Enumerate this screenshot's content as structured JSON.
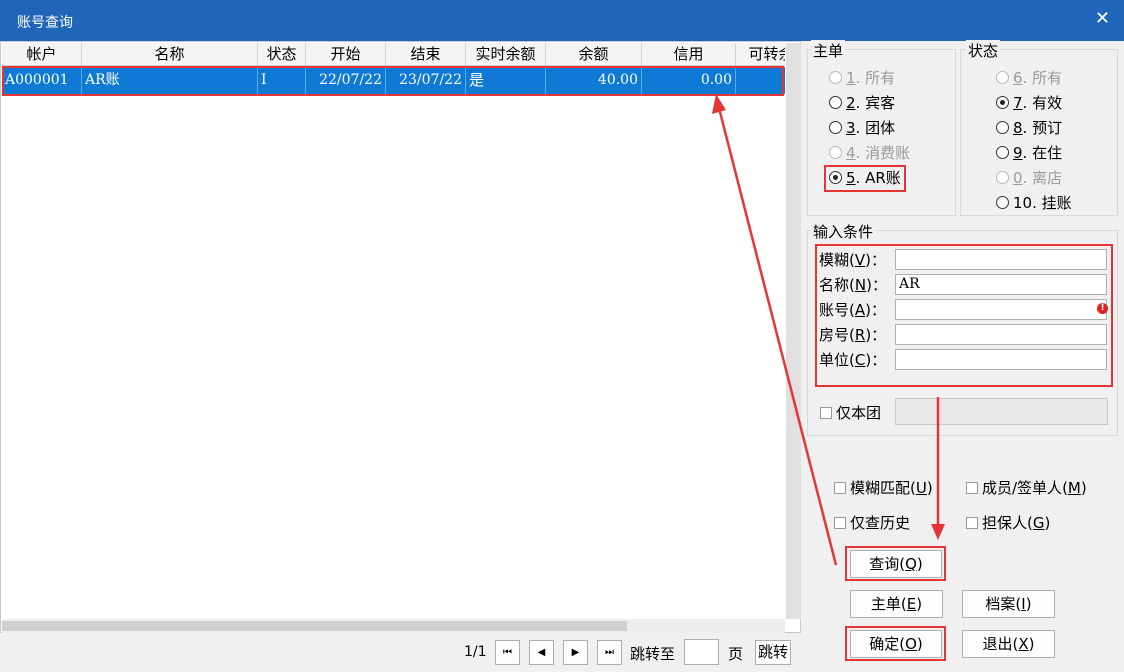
{
  "window": {
    "title": "账号查询",
    "close_glyph": "✕"
  },
  "grid": {
    "headers": [
      "帐户",
      "名称",
      "状态",
      "开始",
      "结束",
      "实时余额",
      "余额",
      "信用",
      "可转余"
    ],
    "rows": [
      [
        "A000001",
        "AR账",
        "I",
        "22/07/22",
        "23/07/22",
        "是",
        "40.00",
        "0.00",
        ""
      ]
    ]
  },
  "pager": {
    "page_info": "1/1",
    "first": "⏮",
    "prev": "◀",
    "next": "▶",
    "last": "⏭",
    "jump_to": "跳转至",
    "page_unit": "页",
    "jump_button": "跳转"
  },
  "main_order": {
    "label": "主单",
    "options": [
      {
        "num": "1",
        "text": ". 所有",
        "disabled": true,
        "selected": false
      },
      {
        "num": "2",
        "text": ". 宾客",
        "disabled": false,
        "selected": false
      },
      {
        "num": "3",
        "text": ". 团体",
        "disabled": false,
        "selected": false
      },
      {
        "num": "4",
        "text": ". 消费账",
        "disabled": true,
        "selected": false
      },
      {
        "num": "5",
        "text": ". AR账",
        "disabled": false,
        "selected": true
      }
    ]
  },
  "status": {
    "label": "状态",
    "options": [
      {
        "num": "6",
        "text": ". 所有",
        "disabled": true,
        "selected": false
      },
      {
        "num": "7",
        "text": ". 有效",
        "disabled": false,
        "selected": true
      },
      {
        "num": "8",
        "text": ". 预订",
        "disabled": false,
        "selected": false
      },
      {
        "num": "9",
        "text": ". 在住",
        "disabled": false,
        "selected": false
      },
      {
        "num": "0",
        "text": ". 离店",
        "disabled": true,
        "selected": false
      },
      {
        "num": "10",
        "text": ". 挂账",
        "disabled": false,
        "selected": false
      }
    ]
  },
  "conditions": {
    "label": "输入条件",
    "fields": [
      {
        "label": "模糊",
        "key": "V",
        "value": ""
      },
      {
        "label": "名称",
        "key": "N",
        "value": "AR"
      },
      {
        "label": "账号",
        "key": "A",
        "value": ""
      },
      {
        "label": "房号",
        "key": "R",
        "value": ""
      },
      {
        "label": "单位",
        "key": "C",
        "value": ""
      }
    ],
    "group_only": "仅本团",
    "error_glyph": "!"
  },
  "options": {
    "fuzzy": {
      "label": "模糊匹配",
      "key": "U"
    },
    "member": {
      "label": "成员/签单人",
      "key": "M"
    },
    "history": {
      "label": "仅查历史"
    },
    "guarantor": {
      "label": "担保人",
      "key": "G"
    }
  },
  "buttons": {
    "query": {
      "label": "查询",
      "key": "Q"
    },
    "main": {
      "label": "主单",
      "key": "E"
    },
    "archive": {
      "label": "档案",
      "key": "I"
    },
    "ok": {
      "label": "确定",
      "key": "O"
    },
    "exit": {
      "label": "退出",
      "key": "X"
    }
  },
  "colors": {
    "titlebar": "#1f66b8",
    "selection": "#0f7ad6",
    "highlight": "#e53535"
  }
}
